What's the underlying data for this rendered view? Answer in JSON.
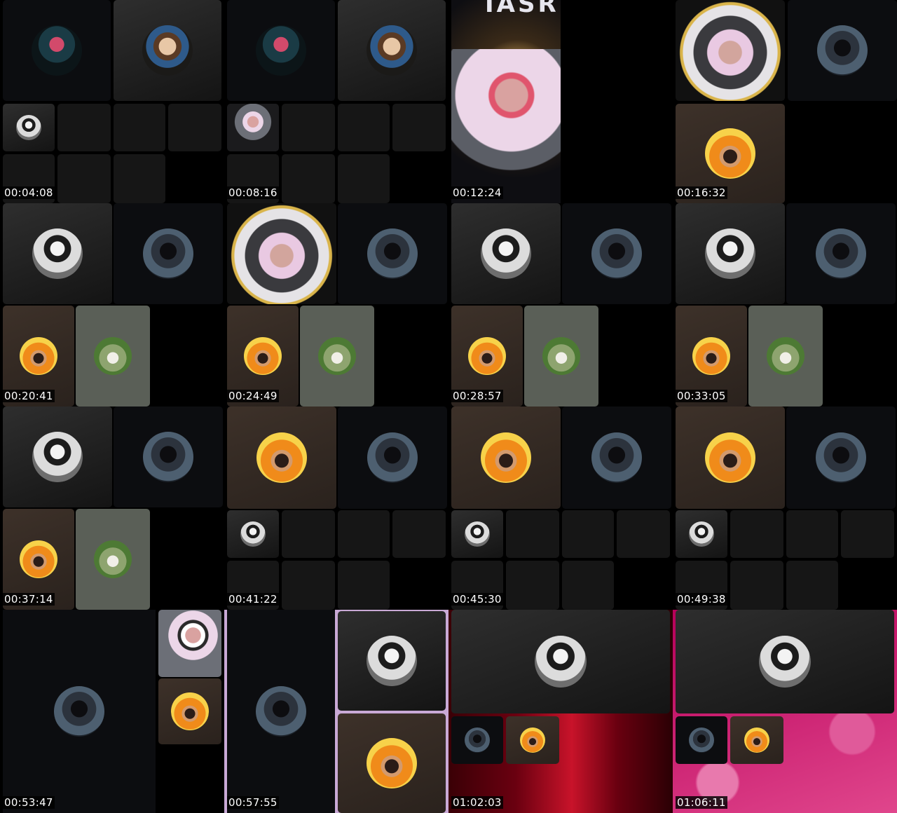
{
  "frames": [
    {
      "time": "00:04:08"
    },
    {
      "time": "00:08:16"
    },
    {
      "time": "00:12:24",
      "overlay_text": "IASRY"
    },
    {
      "time": "00:16:32"
    },
    {
      "time": "00:20:41"
    },
    {
      "time": "00:24:49"
    },
    {
      "time": "00:28:57"
    },
    {
      "time": "00:33:05"
    },
    {
      "time": "00:37:14"
    },
    {
      "time": "00:41:22"
    },
    {
      "time": "00:45:30"
    },
    {
      "time": "00:49:38"
    },
    {
      "time": "00:53:47"
    },
    {
      "time": "00:57:55"
    },
    {
      "time": "01:02:03"
    },
    {
      "time": "01:06:11"
    }
  ]
}
